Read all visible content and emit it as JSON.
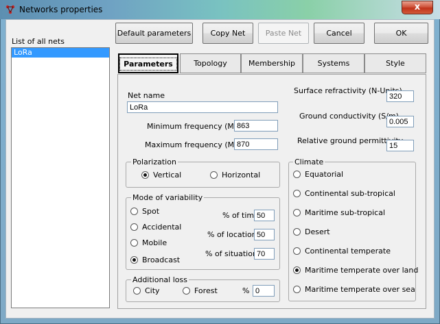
{
  "window": {
    "title": "Networks properties",
    "close_glyph": "x"
  },
  "toolbar": {
    "default_params": "Default parameters",
    "copy_net": "Copy Net",
    "paste_net": "Paste Net",
    "cancel": "Cancel",
    "ok": "OK"
  },
  "nets": {
    "label": "List of all nets",
    "items": [
      "LoRa"
    ]
  },
  "tabs": [
    "Parameters",
    "Topology",
    "Membership",
    "Systems",
    "Style"
  ],
  "params": {
    "net_name_label": "Net name",
    "net_name": "LoRa",
    "min_freq_label": "Minimum frequency (MHz)",
    "min_freq": "863",
    "max_freq_label": "Maximum frequency (MHz)",
    "max_freq": "870",
    "surface_refr_label": "Surface refractivity (N-Units)",
    "surface_refr": "320",
    "ground_cond_label": "Ground conductivity (S/m)",
    "ground_cond": "0.005",
    "rel_perm_label": "Relative ground permittivity",
    "rel_perm": "15"
  },
  "polarization": {
    "label": "Polarization",
    "vertical": "Vertical",
    "horizontal": "Horizontal",
    "selected": "Vertical"
  },
  "variability": {
    "label": "Mode of variability",
    "modes": [
      "Spot",
      "Accidental",
      "Mobile",
      "Broadcast"
    ],
    "selected": "Broadcast",
    "time_label": "% of time",
    "time": "50",
    "locations_label": "% of locations",
    "locations": "50",
    "situations_label": "% of situations",
    "situations": "70"
  },
  "additional_loss": {
    "label": "Additional loss",
    "city": "City",
    "forest": "Forest",
    "pct_label": "%",
    "pct": "0"
  },
  "climate": {
    "label": "Climate",
    "options": [
      "Equatorial",
      "Continental sub-tropical",
      "Maritime sub-tropical",
      "Desert",
      "Continental temperate",
      "Maritime temperate over land",
      "Maritime temperate over sea"
    ],
    "selected": "Maritime temperate over land"
  }
}
